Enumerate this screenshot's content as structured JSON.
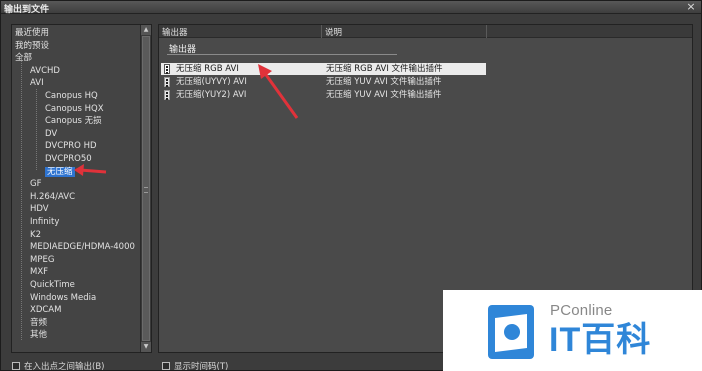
{
  "window": {
    "title": "输出到文件",
    "close_label": "×"
  },
  "tree": {
    "items": [
      {
        "label": "最近使用",
        "level": 0
      },
      {
        "label": "我的预设",
        "level": 0
      },
      {
        "label": "全部",
        "level": 0
      },
      {
        "label": "AVCHD",
        "level": 1
      },
      {
        "label": "AVI",
        "level": 1
      },
      {
        "label": "Canopus HQ",
        "level": 2
      },
      {
        "label": "Canopus HQX",
        "level": 2
      },
      {
        "label": "Canopus 无损",
        "level": 2
      },
      {
        "label": "DV",
        "level": 2
      },
      {
        "label": "DVCPRO HD",
        "level": 2
      },
      {
        "label": "DVCPRO50",
        "level": 2
      },
      {
        "label": "无压缩",
        "level": 2,
        "selected": true
      },
      {
        "label": "GF",
        "level": 1
      },
      {
        "label": "H.264/AVC",
        "level": 1
      },
      {
        "label": "HDV",
        "level": 1
      },
      {
        "label": "Infinity",
        "level": 1
      },
      {
        "label": "K2",
        "level": 1
      },
      {
        "label": "MEDIAEDGE/HDMA-4000",
        "level": 1
      },
      {
        "label": "MPEG",
        "level": 1
      },
      {
        "label": "MXF",
        "level": 1
      },
      {
        "label": "QuickTime",
        "level": 1
      },
      {
        "label": "Windows Media",
        "level": 1
      },
      {
        "label": "XDCAM",
        "level": 1
      },
      {
        "label": "音频",
        "level": 1
      },
      {
        "label": "其他",
        "level": 1
      }
    ]
  },
  "list": {
    "columns": [
      "输出器",
      "说明"
    ],
    "group_label": "输出器",
    "rows": [
      {
        "name": "无压缩 RGB AVI",
        "desc": "无压缩 RGB AVI 文件输出插件",
        "selected": true
      },
      {
        "name": "无压缩(UYVY) AVI",
        "desc": "无压缩 YUV AVI 文件输出插件",
        "selected": false
      },
      {
        "name": "无压缩(YUY2) AVI",
        "desc": "无压缩 YUV AVI 文件输出插件",
        "selected": false
      }
    ]
  },
  "footer": {
    "checkbox_in_out": "在入出点之间输出(B)",
    "checkbox_timecode": "显示时间码(T)"
  },
  "watermark": {
    "brand": "PConline",
    "title": "IT百科"
  },
  "colors": {
    "selection": "#2f74d0",
    "arrow": "#e0323a",
    "brand_blue": "#2f86d8"
  }
}
